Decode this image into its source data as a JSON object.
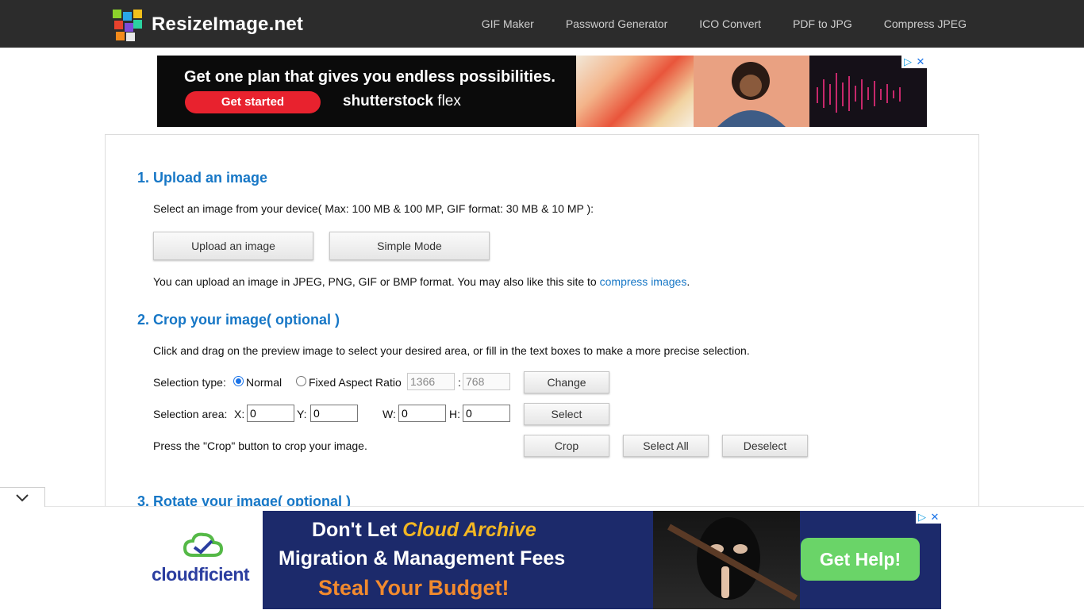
{
  "site": {
    "name": "ResizeImage.net"
  },
  "nav": {
    "items": [
      "GIF Maker",
      "Password Generator",
      "ICO Convert",
      "PDF to JPG",
      "Compress JPEG"
    ]
  },
  "ad_top": {
    "headline": "Get one plan that gives you endless possibilities.",
    "cta": "Get started",
    "brand_bold": "shutterstock",
    "brand_rest": " flex",
    "adchoice_icon": "▷",
    "close_icon": "✕"
  },
  "section1": {
    "title": "1. Upload an image",
    "desc": "Select an image from your device( Max: 100 MB & 100 MP, GIF format: 30 MB & 10 MP ):",
    "upload_label": "Upload an image",
    "simple_label": "Simple Mode",
    "note_before": "You can upload an image in JPEG, PNG, GIF or BMP format. You may also like this site to ",
    "note_link": "compress images",
    "note_after": "."
  },
  "section2": {
    "title": "2. Crop your image( optional )",
    "desc": "Click and drag on the preview image to select your desired area, or fill in the text boxes to make a more precise selection.",
    "selection_type_label": "Selection type:",
    "normal_label": "Normal",
    "fixed_label": "Fixed Aspect Ratio",
    "ratio_w": "1366",
    "ratio_sep": ":",
    "ratio_h": "768",
    "change_label": "Change",
    "selection_area_label": "Selection area:",
    "x_label": "X:",
    "x_value": "0",
    "y_label": "Y:",
    "y_value": "0",
    "w_label": "W:",
    "w_value": "0",
    "h_label": "H:",
    "h_value": "0",
    "select_label": "Select",
    "press_note": "Press the \"Crop\" button to crop your image.",
    "crop_label": "Crop",
    "select_all_label": "Select All",
    "deselect_label": "Deselect"
  },
  "section3": {
    "title": "3. Rotate your image( optional )"
  },
  "ad_bottom": {
    "line1_a": "Don't Let ",
    "line1_b": "Cloud Archive",
    "line2": "Migration & Management Fees",
    "line3": "Steal Your Budget!",
    "cta": "Get Help!",
    "logo": "cloudficient",
    "adchoice_icon": "▷",
    "close_icon": "✕"
  },
  "colors": {
    "accent": "#1777c6",
    "header_bg": "#2c2c2c",
    "ad_red": "#e8222e",
    "ad_green": "#6ad468"
  }
}
